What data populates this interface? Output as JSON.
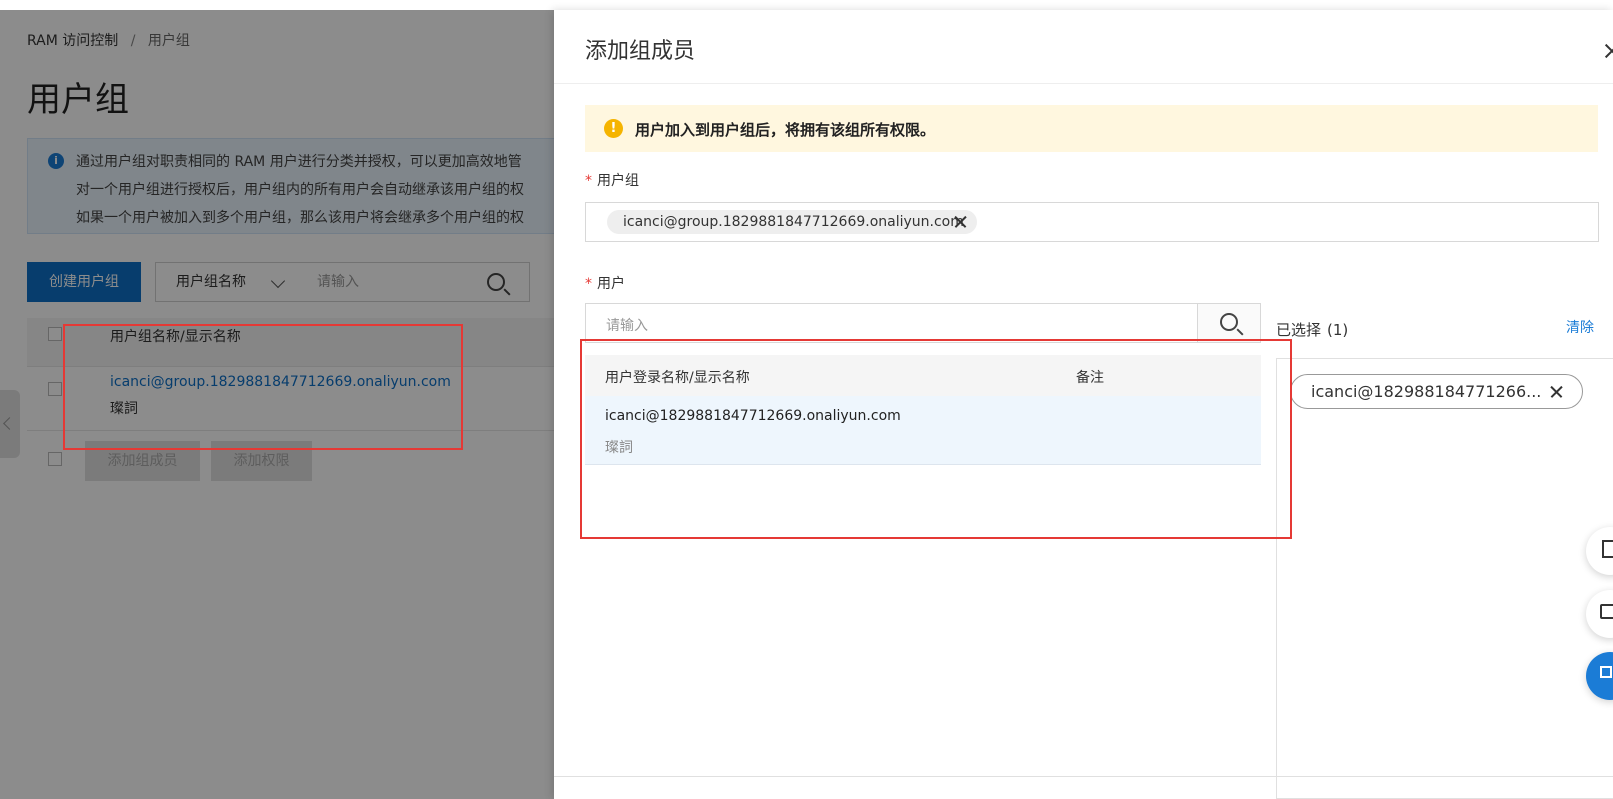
{
  "background": {
    "breadcrumb": {
      "root": "RAM 访问控制",
      "separator": "/",
      "current": "用户组"
    },
    "page_title": "用户组",
    "info_lines": [
      "通过用户组对职责相同的 RAM 用户进行分类并授权，可以更加高效地管",
      "对一个用户组进行授权后，用户组内的所有用户会自动继承该用户组的权",
      "如果一个用户被加入到多个用户组，那么该用户将会继承多个用户组的权"
    ],
    "create_button": "创建用户组",
    "filter_select": "用户组名称",
    "filter_placeholder": "请输入",
    "table_header": "用户组名称/显示名称",
    "row": {
      "name": "icanci@group.1829881847712669.onaliyun.com",
      "display": "璨詞"
    },
    "add_member_button": "添加组成员",
    "add_permission_button": "添加权限"
  },
  "drawer": {
    "title": "添加组成员",
    "warning": "用户加入到用户组后，将拥有该组所有权限。",
    "group_label": "用户组",
    "group_tag": "icanci@group.1829881847712669.onaliyun.com",
    "user_label": "用户",
    "user_search_placeholder": "请输入",
    "table_headers": {
      "login": "用户登录名称/显示名称",
      "note": "备注"
    },
    "user_row": {
      "login": "icanci@1829881847712669.onaliyun.com",
      "display": "璨詞"
    },
    "selected_label": "已选择",
    "selected_count": "(1)",
    "clear": "清除",
    "selected_tag": "icanci@182988184771266..."
  },
  "colors": {
    "primary": "#0d6fc7",
    "warning_bg": "#fff7df",
    "warning_icon": "#f5b400",
    "highlight": "#e53935"
  }
}
